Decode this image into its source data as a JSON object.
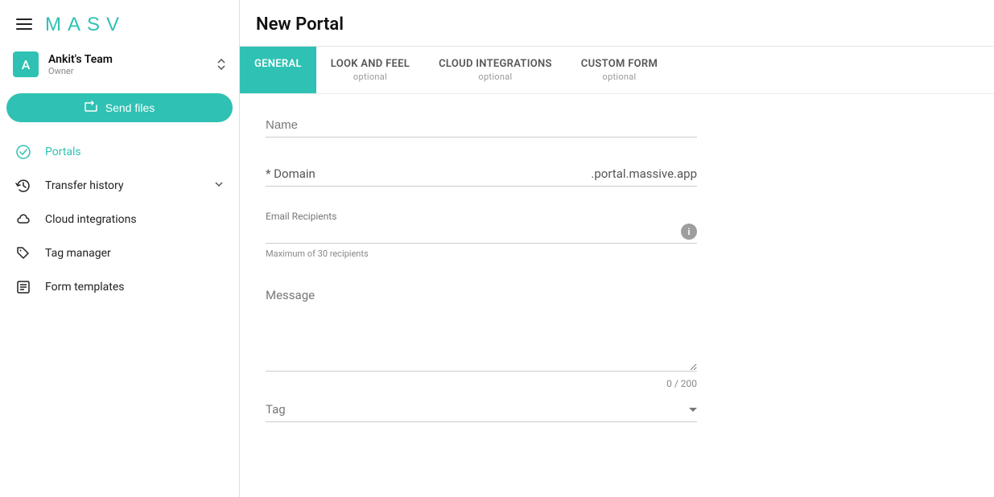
{
  "colors": {
    "accent": "#2fc1b3"
  },
  "logo": {
    "text": "MASV"
  },
  "team": {
    "avatar_letter": "A",
    "name": "Ankit's Team",
    "role": "Owner"
  },
  "sidebar": {
    "send_button": "Send files",
    "items": [
      {
        "label": "Portals"
      },
      {
        "label": "Transfer history"
      },
      {
        "label": "Cloud integrations"
      },
      {
        "label": "Tag manager"
      },
      {
        "label": "Form templates"
      }
    ]
  },
  "page": {
    "title": "New Portal"
  },
  "tabs": [
    {
      "label": "GENERAL",
      "optional": ""
    },
    {
      "label": "LOOK AND FEEL",
      "optional": "optional"
    },
    {
      "label": "CLOUD INTEGRATIONS",
      "optional": "optional"
    },
    {
      "label": "CUSTOM FORM",
      "optional": "optional"
    }
  ],
  "form": {
    "name": {
      "placeholder": "Name",
      "value": ""
    },
    "domain": {
      "label": "* Domain",
      "value": "",
      "suffix": ".portal.massive.app"
    },
    "recipients": {
      "label": "Email Recipients",
      "value": "",
      "helper": "Maximum of 30 recipients"
    },
    "message": {
      "placeholder": "Message",
      "value": "",
      "counter": "0 / 200"
    },
    "tag": {
      "label": "Tag",
      "selected": ""
    }
  }
}
